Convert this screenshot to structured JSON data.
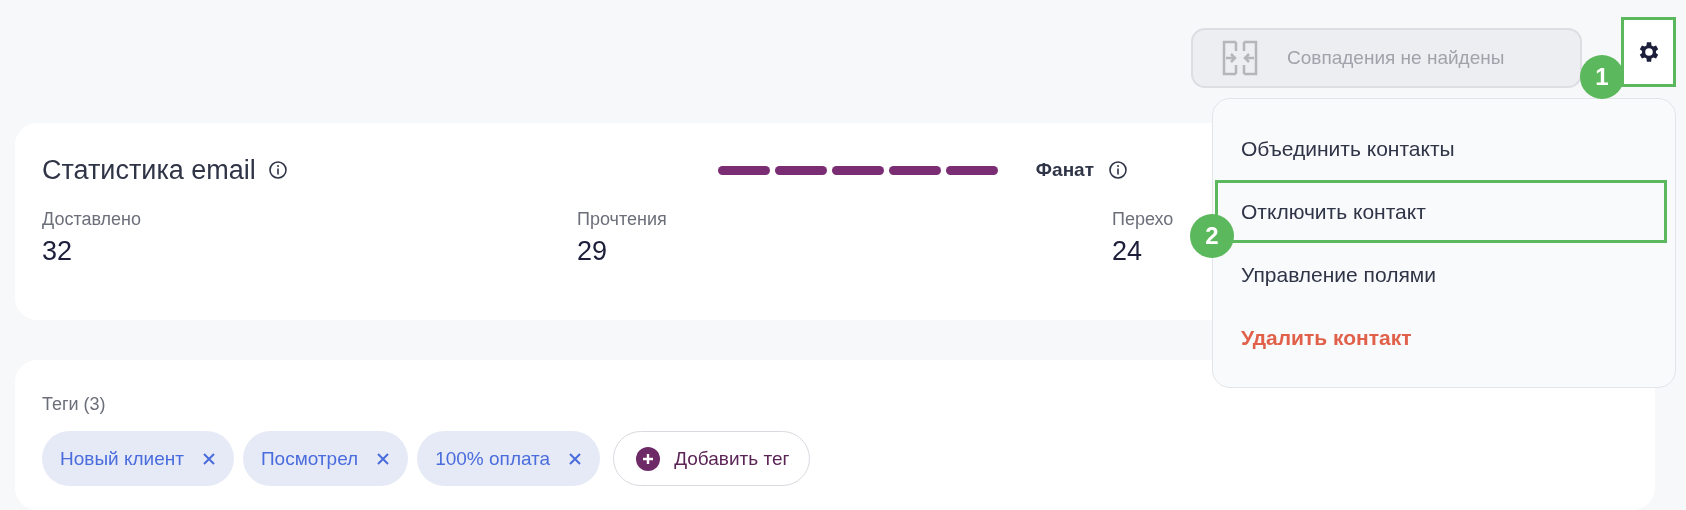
{
  "toolbar": {
    "match_button": {
      "label": "Совпадения не найдены",
      "disabled": true
    },
    "settings_button": {
      "highlighted": true,
      "badge": "1"
    }
  },
  "menu": {
    "items": [
      {
        "label": "Объединить контакты",
        "kind": "normal",
        "highlighted": false
      },
      {
        "label": "Отключить контакт",
        "kind": "normal",
        "highlighted": true,
        "badge": "2"
      },
      {
        "label": "Управление полями",
        "kind": "normal",
        "highlighted": false
      },
      {
        "label": "Удалить контакт",
        "kind": "danger",
        "highlighted": false
      }
    ]
  },
  "email_stats": {
    "title": "Статистика email",
    "engagement": {
      "stars": 5,
      "label": "Фанат"
    },
    "metrics": [
      {
        "label": "Доставлено",
        "value": "32"
      },
      {
        "label": "Прочтения",
        "value": "29"
      },
      {
        "label": "Перехо",
        "value": "24"
      }
    ]
  },
  "tags": {
    "title": "Теги (3)",
    "items": [
      {
        "label": "Новый клиент"
      },
      {
        "label": "Посмотрел"
      },
      {
        "label": "100% оплата"
      }
    ],
    "add_button": "Добавить тег"
  }
}
